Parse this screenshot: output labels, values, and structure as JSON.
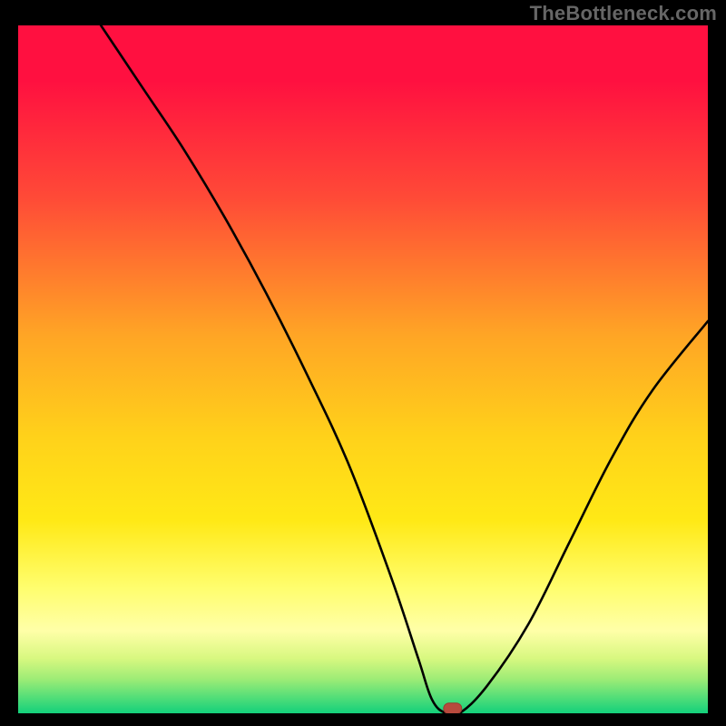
{
  "watermark": "TheBottleneck.com",
  "chart_data": {
    "type": "line",
    "title": "",
    "xlabel": "",
    "ylabel": "",
    "xlim": [
      0,
      100
    ],
    "ylim": [
      0,
      100
    ],
    "grid": false,
    "series": [
      {
        "name": "bottleneck-curve",
        "x": [
          12,
          18,
          24,
          30,
          36,
          42,
          48,
          54,
          58,
          60,
          62,
          64,
          68,
          74,
          80,
          86,
          92,
          100
        ],
        "y": [
          100,
          91,
          82,
          72,
          61,
          49,
          36,
          20,
          8,
          2,
          0,
          0,
          4,
          13,
          25,
          37,
          47,
          57
        ]
      }
    ],
    "markers": [
      {
        "name": "optimal-point",
        "x": 63,
        "y": 0.7
      }
    ],
    "gradient_stops": [
      {
        "pos": 0,
        "color": "#ff1040"
      },
      {
        "pos": 8,
        "color": "#ff1040"
      },
      {
        "pos": 25,
        "color": "#ff4a37"
      },
      {
        "pos": 45,
        "color": "#ffa525"
      },
      {
        "pos": 60,
        "color": "#ffd21a"
      },
      {
        "pos": 72,
        "color": "#ffe916"
      },
      {
        "pos": 82,
        "color": "#fffe70"
      },
      {
        "pos": 88,
        "color": "#ffffa8"
      },
      {
        "pos": 92,
        "color": "#d8f880"
      },
      {
        "pos": 95,
        "color": "#9eec76"
      },
      {
        "pos": 97.5,
        "color": "#58df78"
      },
      {
        "pos": 100,
        "color": "#13d07b"
      }
    ]
  }
}
